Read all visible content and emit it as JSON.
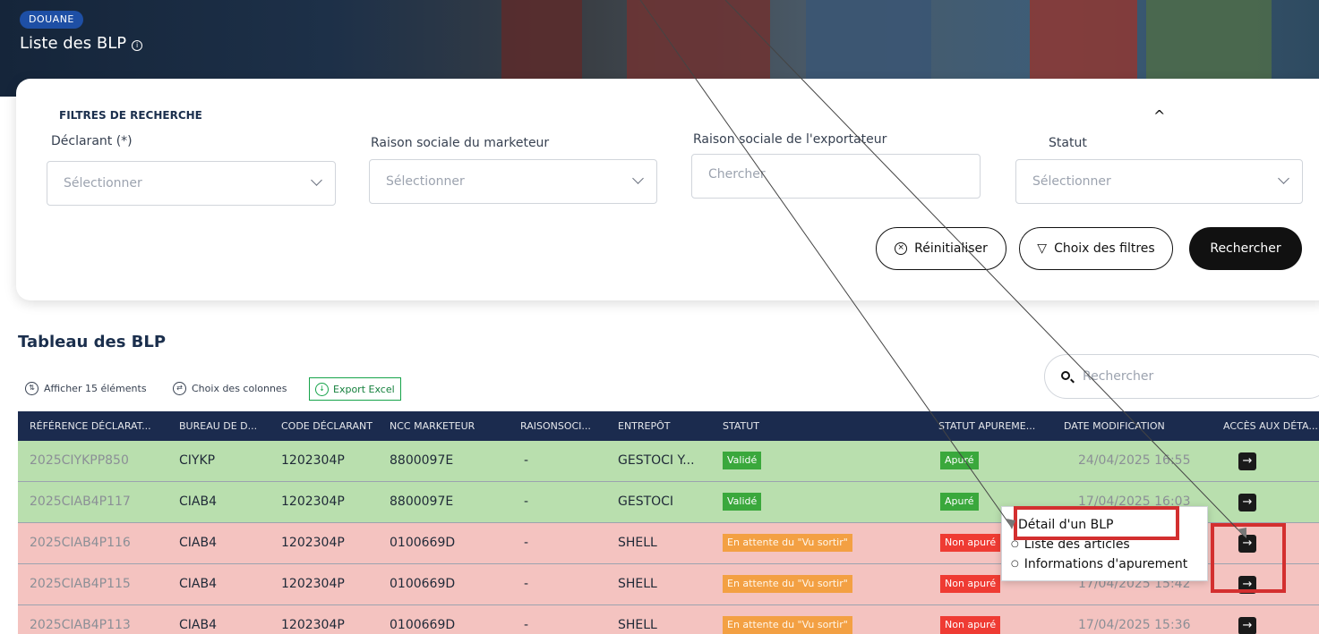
{
  "header": {
    "badge": "DOUANE",
    "title": "Liste des BLP"
  },
  "filters": {
    "title": "FILTRES DE RECHERCHE",
    "declarant": {
      "label": "Déclarant (*)",
      "placeholder": "Sélectionner"
    },
    "marketeur": {
      "label": "Raison sociale du marketeur",
      "placeholder": "Sélectionner"
    },
    "exportateur": {
      "label": "Raison sociale de l'exportateur",
      "placeholder": "Chercher"
    },
    "statut": {
      "label": "Statut",
      "placeholder": "Sélectionner"
    },
    "reset_label": "Réinitialiser",
    "choose_filters_label": "Choix des filtres",
    "search_label": "Rechercher"
  },
  "table": {
    "title": "Tableau des BLP",
    "show_label": "Afficher 15 éléments",
    "columns_label": "Choix des colonnes",
    "export_label": "Export Excel",
    "search_placeholder": "Rechercher",
    "headers": [
      "RÉFÉRENCE DÉCLARAT...",
      "BUREAU DE D...",
      "CODE DÉCLARANT",
      "NCC MARKETEUR",
      "RAISONSOCI...",
      "ENTREPÔT",
      "STATUT",
      "STATUT APUREME...",
      "DATE MODIFICATION",
      "ACCÈS AUX DÉTA..."
    ],
    "rows": [
      {
        "ref": "2025CIYKPP850",
        "bureau": "CIYKP",
        "code": "1202304P",
        "ncc": "8800097E",
        "raison": "-",
        "entrepot": "GESTOCI Y...",
        "statut": "Validé",
        "apurement": "Apuré",
        "date": "24/04/2025 16:55",
        "color": "green"
      },
      {
        "ref": "2025CIAB4P117",
        "bureau": "CIAB4",
        "code": "1202304P",
        "ncc": "8800097E",
        "raison": "-",
        "entrepot": "GESTOCI",
        "statut": "Validé",
        "apurement": "Apuré",
        "date": "17/04/2025 16:03",
        "color": "green"
      },
      {
        "ref": "2025CIAB4P116",
        "bureau": "CIAB4",
        "code": "1202304P",
        "ncc": "0100669D",
        "raison": "-",
        "entrepot": "SHELL",
        "statut": "En attente du \"Vu sortir\"",
        "apurement": "Non apuré",
        "date": "",
        "color": "red"
      },
      {
        "ref": "2025CIAB4P115",
        "bureau": "CIAB4",
        "code": "1202304P",
        "ncc": "0100669D",
        "raison": "-",
        "entrepot": "SHELL",
        "statut": "En attente du \"Vu sortir\"",
        "apurement": "Non apuré",
        "date": "17/04/2025 15:42",
        "color": "red"
      },
      {
        "ref": "2025CIAB4P113",
        "bureau": "CIAB4",
        "code": "1202304P",
        "ncc": "0100669D",
        "raison": "-",
        "entrepot": "SHELL",
        "statut": "En attente du \"Vu sortir\"",
        "apurement": "Non apuré",
        "date": "17/04/2025 15:36",
        "color": "red"
      }
    ]
  },
  "context_menu": {
    "items": [
      "Détail d'un BLP",
      "Liste des articles",
      "Informations d'apurement"
    ]
  },
  "colors": {
    "accent": "#1b2b4e",
    "highlight": "#d32f2f",
    "row_green": "#b9dfae",
    "row_red": "#f4c3c0"
  }
}
